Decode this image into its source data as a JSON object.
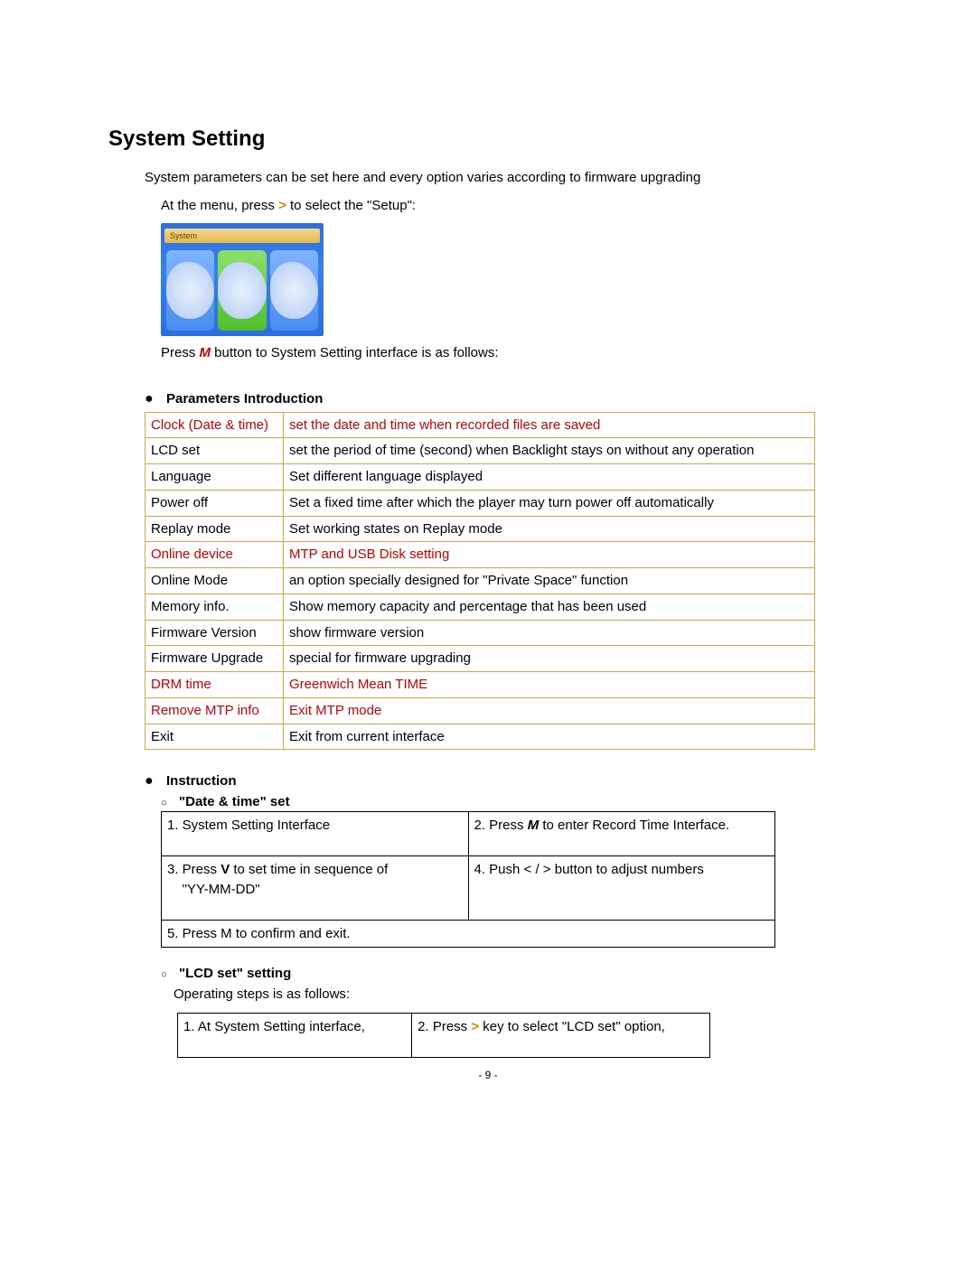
{
  "heading": "System Setting",
  "intro": "System parameters can be set here and every option varies according to firmware upgrading",
  "step_menu_pre": "At the menu, press ",
  "gt": ">",
  "step_menu_post": " to select the \"Setup\":",
  "screenshot_label": "System",
  "press_m_pre": "Press ",
  "m_label": "M",
  "press_m_post": " button to System Setting interface is as follows:",
  "section_params": "Parameters Introduction",
  "params": [
    {
      "name": "Clock (Date & time)",
      "desc": "set the date and time when recorded files are saved",
      "red": true
    },
    {
      "name": "LCD set",
      "desc": "set the period of time (second) when Backlight stays on without any operation",
      "red": false
    },
    {
      "name": "Language",
      "desc": "Set different language displayed",
      "red": false
    },
    {
      "name": "Power off",
      "desc": "Set a fixed time after which the player may turn power off automatically",
      "red": false
    },
    {
      "name": "Replay mode",
      "desc": "Set working states on Replay mode",
      "red": false
    },
    {
      "name": "Online device",
      "desc": "MTP and USB Disk setting",
      "red": true
    },
    {
      "name": "Online Mode",
      "desc": "an option specially designed for \"Private Space\" function",
      "red": false
    },
    {
      "name": "Memory info.",
      "desc": "Show memory capacity and percentage that has been used",
      "red": false
    },
    {
      "name": "Firmware Version",
      "desc": "show firmware version",
      "red": false
    },
    {
      "name": "Firmware Upgrade",
      "desc": "special for firmware upgrading",
      "red": false
    },
    {
      "name": "DRM time",
      "desc": "Greenwich Mean TIME",
      "red": true
    },
    {
      "name": "Remove MTP info",
      "desc": "Exit MTP mode",
      "red": true
    },
    {
      "name": "Exit",
      "desc": "Exit from current interface",
      "red": false
    }
  ],
  "section_instruction": "Instruction",
  "sub_datetime": "\"Date & time\" set",
  "dt_steps": {
    "s1": "1. System Setting Interface",
    "s2_pre": "2. Press ",
    "s2_m": "M",
    "s2_post": " to enter Record Time Interface.",
    "s3_pre": "3. Press ",
    "s3_v": "V",
    "s3_mid": " to set time in sequence of",
    "s3_line2": "\"YY-MM-DD\"",
    "s4": "4. Push < / > button to adjust numbers",
    "s5": "5. Press M to confirm and exit."
  },
  "sub_lcd": "\"LCD set\" setting",
  "lcd_intro": "Operating steps is as follows:",
  "lcd_steps": {
    "s1": "1.  At System Setting interface,",
    "s2_pre": "2. Press ",
    "s2_gt": ">",
    "s2_post": " key to select \"LCD set\" option,"
  },
  "page_number": "- 9 -"
}
